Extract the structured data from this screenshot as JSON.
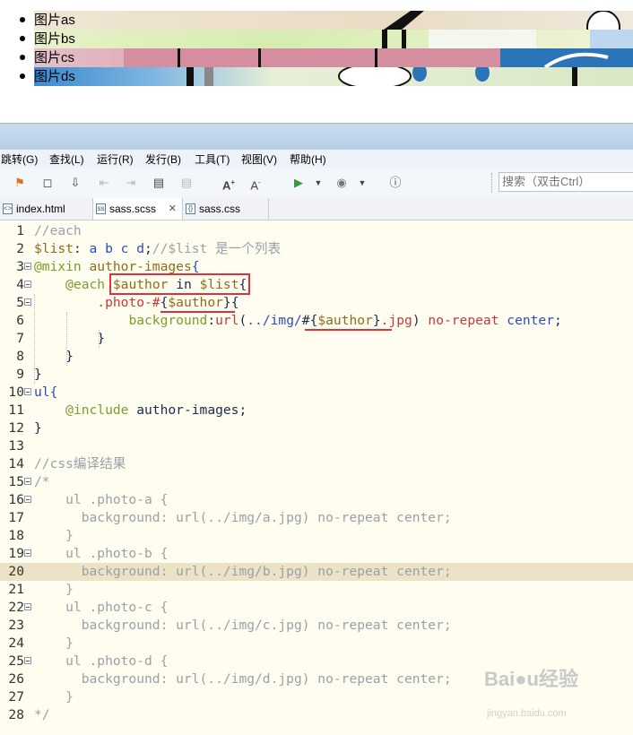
{
  "preview": {
    "items": [
      {
        "label": "图片as"
      },
      {
        "label": "图片bs"
      },
      {
        "label": "图片cs"
      },
      {
        "label": "图片ds"
      }
    ]
  },
  "ide": {
    "menu": [
      "跳转(G)",
      "查找(L)",
      "运行(R)",
      "发行(B)",
      "工具(T)",
      "视图(V)",
      "帮助(H)"
    ],
    "search_placeholder": "搜索（双击Ctrl）",
    "tabs": [
      {
        "label": "index.html",
        "active": false
      },
      {
        "label": "sass.scss",
        "active": true,
        "closable": true
      },
      {
        "label": "sass.css",
        "active": false
      }
    ],
    "highlighted_line": 20,
    "code_lines": [
      "//each",
      "$list: a b c d;//$list 是一个列表",
      "@mixin author-images{",
      "    @each $author in $list{",
      "        .photo-#{$author}{",
      "            background:url(../img/#{$author}.jpg) no-repeat center;",
      "        }",
      "    }",
      "}",
      "ul{",
      "    @include author-images;",
      "}",
      "",
      "//css编译结果",
      "/*",
      "    ul .photo-a {",
      "      background: url(../img/a.jpg) no-repeat center;",
      "    }",
      "    ul .photo-b {",
      "      background: url(../img/b.jpg) no-repeat center;",
      "    }",
      "    ul .photo-c {",
      "      background: url(../img/c.jpg) no-repeat center;",
      "    }",
      "    ul .photo-d {",
      "      background: url(../img/d.jpg) no-repeat center;",
      "    }",
      "*/"
    ]
  },
  "watermark": {
    "brand": "Baidu经验",
    "url": "jingyan.baidu.com"
  }
}
